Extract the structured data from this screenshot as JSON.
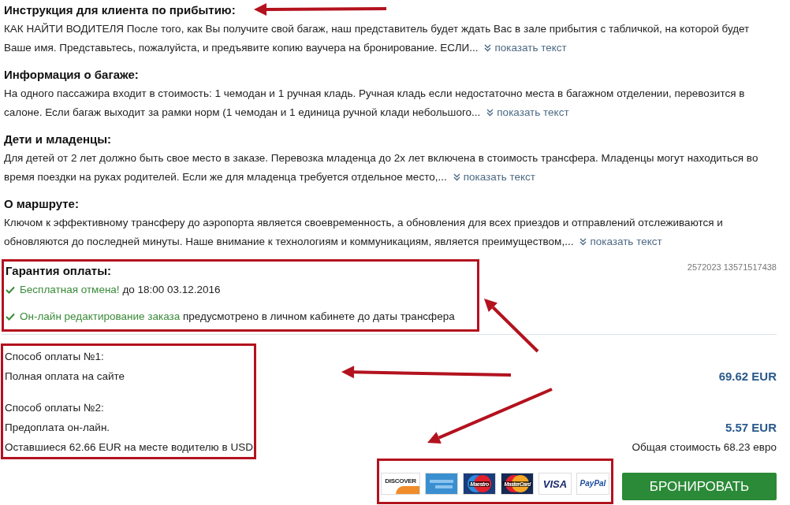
{
  "sections": [
    {
      "title": "Инструкция для клиента по прибытию:",
      "text": "КАК НАЙТИ ВОДИТЕЛЯ После того, как Вы получите свой багаж, наш представитель будет ждать Вас в зале прибытия с табличкой, на которой будет Ваше имя. Представьтесь, пожалуйста, и предъявите копию ваучера на бронирование. ЕСЛИ...",
      "more_link": "показать текст"
    },
    {
      "title": "Информация о багаже:",
      "text": "На одного пассажира входит в стоимость: 1 чемодан и 1 ручная кладь. Ручная кладь если недостаточно места в багажном отделении, перевозится в салоне. Если багаж выходит за рамки норм (1 чемодан и 1 единица ручной клади небольшого...",
      "more_link": "показать текст"
    },
    {
      "title": "Дети и младенцы:",
      "text": "Для детей от 2 лет должно быть свое место в заказе. Перевозка младенца до 2х лет включена в стоимость трансфера. Младенцы могут находиться во время поездки на руках родителей. Если же для младенца требуется отдельное место,...",
      "more_link": "показать текст"
    },
    {
      "title": "О маршруте:",
      "text": "Ключом к эффективному трансферу до аэропорта является своевременность, а обновления для всех приездов и отправлений отслеживаются и обновляются до последней минуты. Наше внимание к технологиям и коммуникациям, является преимуществом,...",
      "more_link": "показать текст"
    }
  ],
  "guarantee": {
    "title": "Гарантия оплаты:",
    "items": [
      {
        "highlight": "Бесплатная отмена!",
        "text": "до 18:00 03.12.2016"
      },
      {
        "highlight": "Он-лайн редактирование заказа",
        "text": "предусмотрено в личном кабинете до даты трансфера"
      }
    ]
  },
  "reference": "2572023 13571517438",
  "payment_methods": [
    {
      "title": "Способ оплаты №1:",
      "lines": [
        {
          "text": "Полная оплата на сайте",
          "right": {
            "kind": "price",
            "text": "69.62 EUR"
          }
        }
      ]
    },
    {
      "title": "Способ оплаты №2:",
      "lines": [
        {
          "text": "Предоплата он-лайн.",
          "right": {
            "kind": "price",
            "text": "5.57 EUR"
          }
        },
        {
          "text": "Оставшиеся 62.66 EUR на месте водителю в USD",
          "right": {
            "kind": "total",
            "text": "Общая стоимость 68.23 евро"
          }
        }
      ]
    }
  ],
  "cards": [
    {
      "kind": "discover",
      "label": "DISCOVER"
    },
    {
      "kind": "amex"
    },
    {
      "kind": "maestro",
      "label": "Maestro"
    },
    {
      "kind": "mastercard",
      "label": "MasterCard"
    },
    {
      "kind": "visa",
      "label": "VISA"
    },
    {
      "kind": "paypal",
      "label": "PayPal"
    }
  ],
  "book_button": "БРОНИРОВАТЬ"
}
